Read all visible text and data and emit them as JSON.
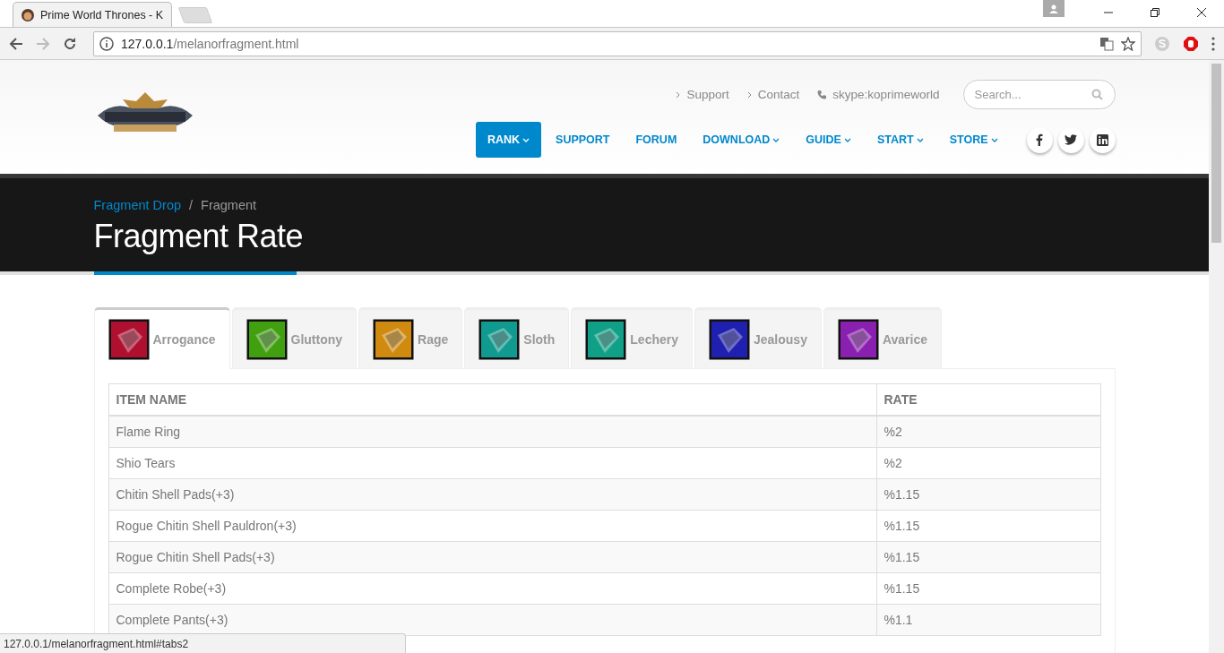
{
  "browser": {
    "tab_title": "Prime World Thrones - K",
    "address_host": "127.0.0.1",
    "address_path": "/melanorfragment.html",
    "status_url": "127.0.0.1/melanorfragment.html#tabs2"
  },
  "top_links": [
    {
      "kind": "link",
      "label": "Support"
    },
    {
      "kind": "link",
      "label": "Contact"
    },
    {
      "kind": "phone",
      "label": "skype:koprimeworld"
    }
  ],
  "search": {
    "placeholder": "Search..."
  },
  "nav": [
    {
      "label": "RANK",
      "selected": true,
      "dropdown": true
    },
    {
      "label": "SUPPORT",
      "selected": false,
      "dropdown": false
    },
    {
      "label": "FORUM",
      "selected": false,
      "dropdown": false
    },
    {
      "label": "DOWNLOAD",
      "selected": false,
      "dropdown": true
    },
    {
      "label": "GUIDE",
      "selected": false,
      "dropdown": true
    },
    {
      "label": "START",
      "selected": false,
      "dropdown": true
    },
    {
      "label": "STORE",
      "selected": false,
      "dropdown": true
    }
  ],
  "social": [
    {
      "kind": "facebook"
    },
    {
      "kind": "twitter"
    },
    {
      "kind": "linkedin"
    }
  ],
  "breadcrumb_separator": "/",
  "breadcrumb": [
    {
      "label": "Fragment Drop",
      "link": true
    },
    {
      "label": "Fragment",
      "link": false
    }
  ],
  "page_title": "Fragment Rate",
  "tabs": [
    {
      "label": "Arrogance",
      "selected": true,
      "color": "#b01030"
    },
    {
      "label": "Gluttony",
      "selected": false,
      "color": "#40a010"
    },
    {
      "label": "Rage",
      "selected": false,
      "color": "#d08a10"
    },
    {
      "label": "Sloth",
      "selected": false,
      "color": "#109a90"
    },
    {
      "label": "Lechery",
      "selected": false,
      "color": "#10a088"
    },
    {
      "label": "Jealousy",
      "selected": false,
      "color": "#2020b0"
    },
    {
      "label": "Avarice",
      "selected": false,
      "color": "#8a20b0"
    }
  ],
  "table": {
    "columns": [
      "ITEM NAME",
      "RATE"
    ],
    "rows": [
      [
        "Flame Ring",
        "%2"
      ],
      [
        "Shio Tears",
        "%2"
      ],
      [
        "Chitin Shell Pads(+3)",
        "%1.15"
      ],
      [
        "Rogue Chitin Shell Pauldron(+3)",
        "%1.15"
      ],
      [
        "Rogue Chitin Shell Pads(+3)",
        "%1.15"
      ],
      [
        "Complete Robe(+3)",
        "%1.15"
      ],
      [
        "Complete Pants(+3)",
        "%1.1"
      ]
    ]
  }
}
